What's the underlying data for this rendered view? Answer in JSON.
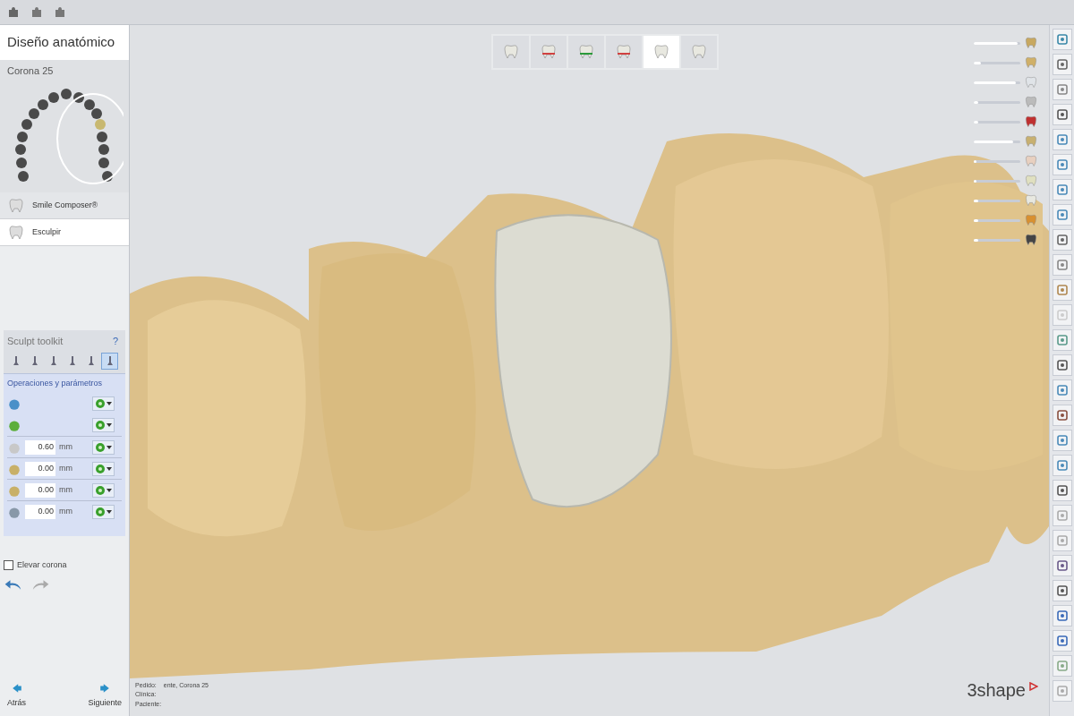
{
  "panel": {
    "title": "Diseño anatómico",
    "subtitle": "Corona 25"
  },
  "design_steps": [
    {
      "label": "Smile Composer®",
      "selected": false
    },
    {
      "label": "Esculpir",
      "selected": true
    }
  ],
  "toolkit": {
    "title": "Sculpt toolkit",
    "help": "?",
    "tools": [
      {
        "selected": false
      },
      {
        "selected": false
      },
      {
        "selected": false
      },
      {
        "selected": false
      },
      {
        "selected": false
      },
      {
        "selected": true
      }
    ],
    "section_title": "Operaciones y parámetros",
    "operations": [
      {
        "kind": "plain"
      },
      {
        "kind": "plain"
      },
      {
        "kind": "value",
        "value": "0.60",
        "unit": "mm"
      },
      {
        "kind": "value",
        "value": "0.00",
        "unit": "mm"
      },
      {
        "kind": "value",
        "value": "0.00",
        "unit": "mm"
      },
      {
        "kind": "value",
        "value": "0.00",
        "unit": "mm"
      }
    ]
  },
  "raise_crown": {
    "label": "Elevar corona",
    "checked": false
  },
  "nav": {
    "back": "Atrás",
    "next": "Siguiente"
  },
  "workflow_steps": [
    {
      "selected": false
    },
    {
      "selected": false
    },
    {
      "selected": false
    },
    {
      "selected": false
    },
    {
      "selected": true
    },
    {
      "selected": false
    }
  ],
  "layers": [
    {
      "level": 0.95
    },
    {
      "level": 0.15
    },
    {
      "level": 0.9
    },
    {
      "level": 0.1
    },
    {
      "level": 0.1
    },
    {
      "level": 0.85
    },
    {
      "level": 0.05
    },
    {
      "level": 0.05
    },
    {
      "level": 0.1
    },
    {
      "level": 0.1
    },
    {
      "level": 0.1
    }
  ],
  "info": [
    {
      "label": "Pedido:",
      "value": "ente, Corona 25"
    },
    {
      "label": "Clínica:"
    },
    {
      "label": "Paciente:"
    }
  ],
  "brand": "3shape"
}
